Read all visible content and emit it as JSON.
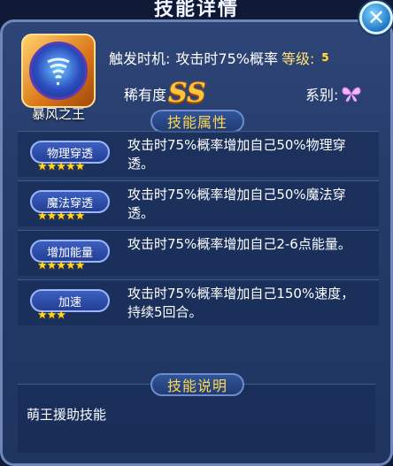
{
  "window": {
    "title": "技能详情"
  },
  "skill": {
    "name": "暴风之王",
    "trigger_label": "触发时机:",
    "trigger_value": "攻击时75%概率",
    "level_label": "等级:",
    "level_value": "5",
    "rarity_label": "稀有度",
    "rarity_value": "SS",
    "series_label": "系别:"
  },
  "sections": {
    "attributes_title": "技能属性",
    "description_title": "技能说明"
  },
  "attributes": [
    {
      "name": "物理穿透",
      "stars": "★★★★★",
      "text": "攻击时75%概率增加自己50%物理穿透。"
    },
    {
      "name": "魔法穿透",
      "stars": "★★★★★",
      "text": "攻击时75%概率增加自己50%魔法穿透。"
    },
    {
      "name": "增加能量",
      "stars": "★★★★★",
      "text": "攻击时75%概率增加自己2-6点能量。"
    },
    {
      "name": "加速",
      "stars": "★★★",
      "text": "攻击时75%概率增加自己150%速度，持续5回合。"
    }
  ],
  "description": {
    "text": "萌王援助技能"
  },
  "icons": {
    "close": "close-icon",
    "skill": "tornado-icon",
    "series": "butterfly-icon",
    "level": "level-chevron-icon"
  },
  "colors": {
    "accent_gold": "#ffd94a",
    "panel_bg": "#2e4577",
    "pill_bg": "#3c5fbf"
  }
}
